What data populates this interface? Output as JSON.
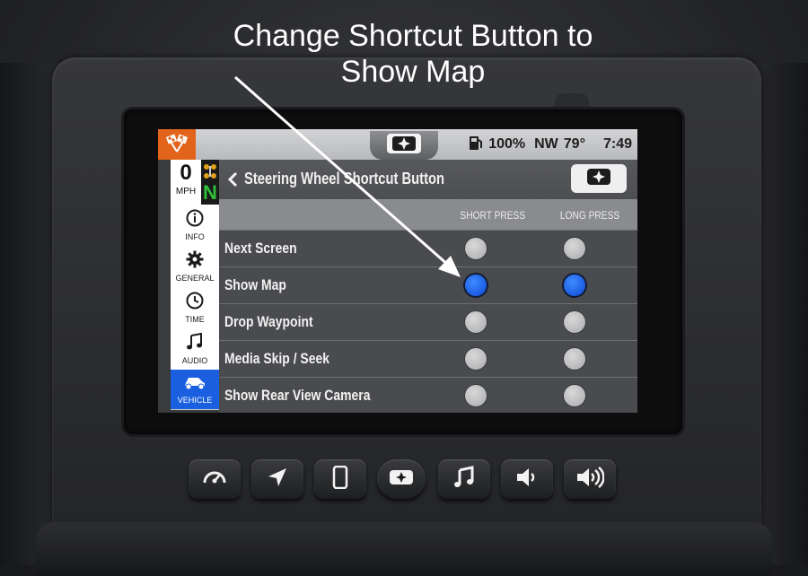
{
  "annotation": {
    "line1": "Change Shortcut Button to",
    "line2": "Show Map"
  },
  "statusbar": {
    "battery": "100%",
    "heading": "NW",
    "temperature": "79°",
    "time": "7:49"
  },
  "speed": {
    "value": "0",
    "unit": "MPH"
  },
  "gear": {
    "value": "N"
  },
  "nav": {
    "items": [
      {
        "label": "INFO",
        "icon": "info-icon"
      },
      {
        "label": "GENERAL",
        "icon": "gear-icon"
      },
      {
        "label": "TIME",
        "icon": "clock-icon"
      },
      {
        "label": "AUDIO",
        "icon": "music-note-icon"
      },
      {
        "label": "VEHICLE",
        "icon": "vehicle-icon"
      }
    ],
    "active": "VEHICLE"
  },
  "page": {
    "title": "Steering Wheel Shortcut Button"
  },
  "columns": {
    "short": "SHORT PRESS",
    "long": "LONG PRESS"
  },
  "rows": [
    {
      "label": "Next Screen",
      "short": false,
      "long": false
    },
    {
      "label": "Show Map",
      "short": true,
      "long": true
    },
    {
      "label": "Drop Waypoint",
      "short": false,
      "long": false
    },
    {
      "label": "Media Skip / Seek",
      "short": false,
      "long": false
    },
    {
      "label": "Show Rear View Camera",
      "short": false,
      "long": false
    }
  ],
  "colors": {
    "accent_orange": "#e2641b",
    "selected_blue": "#1a5fe0",
    "gear_green": "#2fbf3a"
  },
  "hardware_buttons": [
    {
      "icon": "gauge-icon"
    },
    {
      "icon": "navigation-arrow-icon"
    },
    {
      "icon": "phone-icon"
    },
    {
      "icon": "polaris-star-icon"
    },
    {
      "icon": "music-note-icon"
    },
    {
      "icon": "volume-down-icon"
    },
    {
      "icon": "volume-up-icon"
    }
  ]
}
